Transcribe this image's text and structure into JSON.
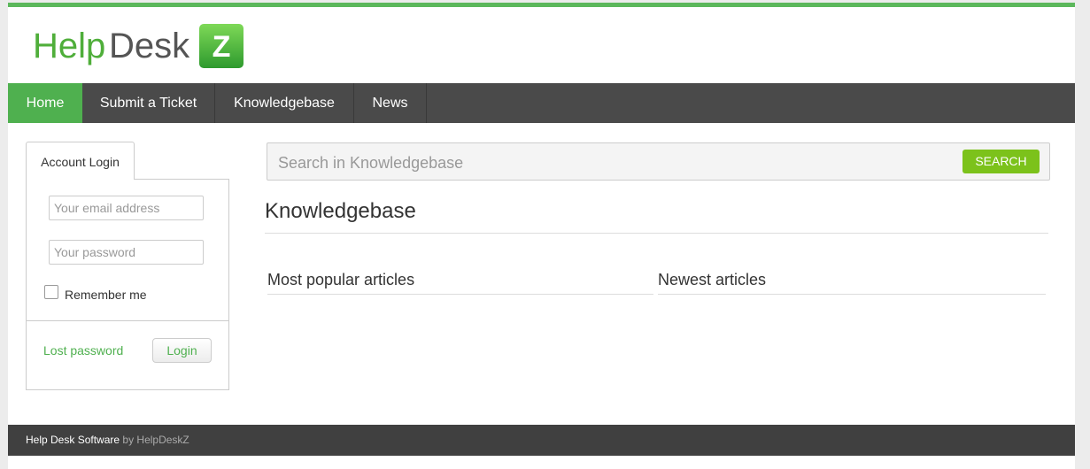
{
  "logo": {
    "text_left": "Help",
    "text_mid": "Desk",
    "text_badge": "Z"
  },
  "nav": {
    "items": [
      {
        "label": "Home"
      },
      {
        "label": "Submit a Ticket"
      },
      {
        "label": "Knowledgebase"
      },
      {
        "label": "News"
      }
    ]
  },
  "login": {
    "tab_label": "Account Login",
    "email_placeholder": "Your email address",
    "password_placeholder": "Your password",
    "remember_label": "Remember me",
    "lost_password_label": "Lost password",
    "login_button_label": "Login"
  },
  "search": {
    "placeholder": "Search in Knowledgebase",
    "button_label": "SEARCH"
  },
  "main": {
    "title": "Knowledgebase",
    "popular_title": "Most popular articles",
    "newest_title": "Newest articles"
  },
  "footer": {
    "brand": "Help Desk Software",
    "by": "by HelpDeskZ"
  },
  "colors": {
    "accent": "#4fb04f",
    "search_button": "#7cc21b",
    "nav_bg": "#4a4a4a",
    "footer_bg": "#404040"
  }
}
